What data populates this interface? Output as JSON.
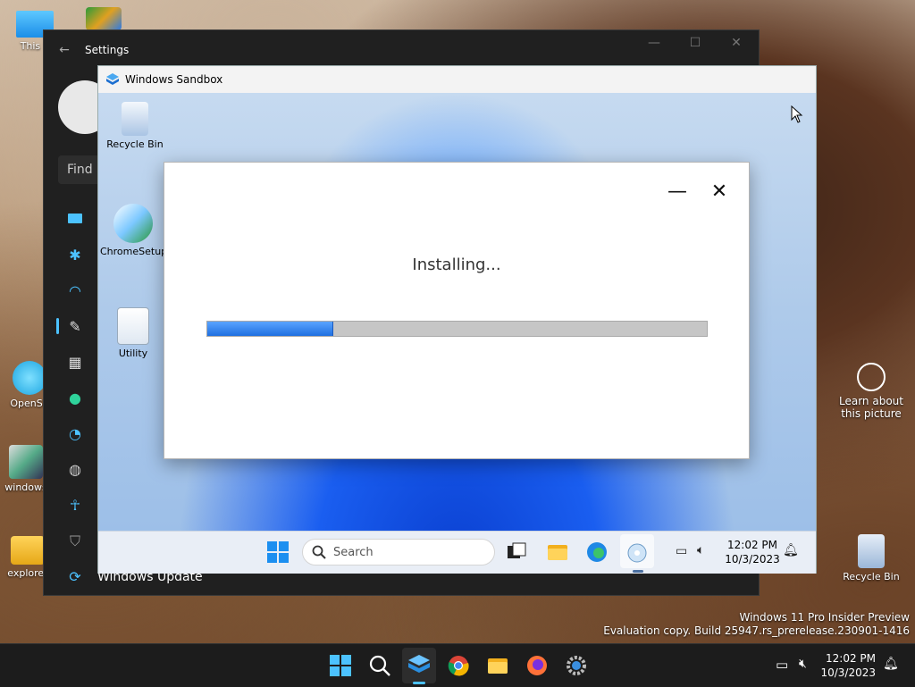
{
  "desktop": {
    "icons_left": [
      {
        "label": "This PC",
        "visible_label": "This P"
      },
      {
        "label": "OpenShell",
        "visible_label": "OpenSh"
      },
      {
        "label": "windows",
        "visible_label": "windows"
      },
      {
        "label": "explorer",
        "visible_label": "explorer"
      }
    ],
    "recycle_bin_label": "Recycle Bin",
    "learn_label": "Learn about this picture",
    "watermark_line1": "Windows 11 Pro Insider Preview",
    "watermark_line2": "Evaluation copy. Build 25947.rs_prerelease.230901-1416"
  },
  "settings": {
    "title": "Settings",
    "search_placeholder": "Find a",
    "back_glyph": "←",
    "minimize_glyph": "—",
    "maximize_glyph": "☐",
    "close_glyph": "✕",
    "nav_icons": [
      "system-icon",
      "bluetooth-icon",
      "network-icon",
      "personalization-icon",
      "apps-icon",
      "accounts-icon",
      "time-icon",
      "gaming-icon",
      "accessibility-icon",
      "privacy-icon",
      "update-icon"
    ],
    "bottom_label": "Windows Update"
  },
  "sandbox": {
    "title": "Windows Sandbox",
    "minimize_glyph": "—",
    "maximize_glyph": "☐",
    "close_glyph": "✕",
    "desktop_icons": [
      {
        "label": "Recycle Bin"
      },
      {
        "label": "ChromeSetup"
      },
      {
        "label": "Utility"
      }
    ],
    "taskbar": {
      "search_placeholder": "Search",
      "time": "12:02 PM",
      "date": "10/3/2023"
    }
  },
  "installer": {
    "status": "Installing...",
    "progress_percent": 25,
    "minimize_glyph": "—",
    "close_glyph": "✕"
  },
  "host_taskbar": {
    "time": "12:02 PM",
    "date": "10/3/2023"
  },
  "colors": {
    "accent": "#4cc2ff",
    "progress": "#2a7ae8",
    "settings_bg": "#202020"
  }
}
